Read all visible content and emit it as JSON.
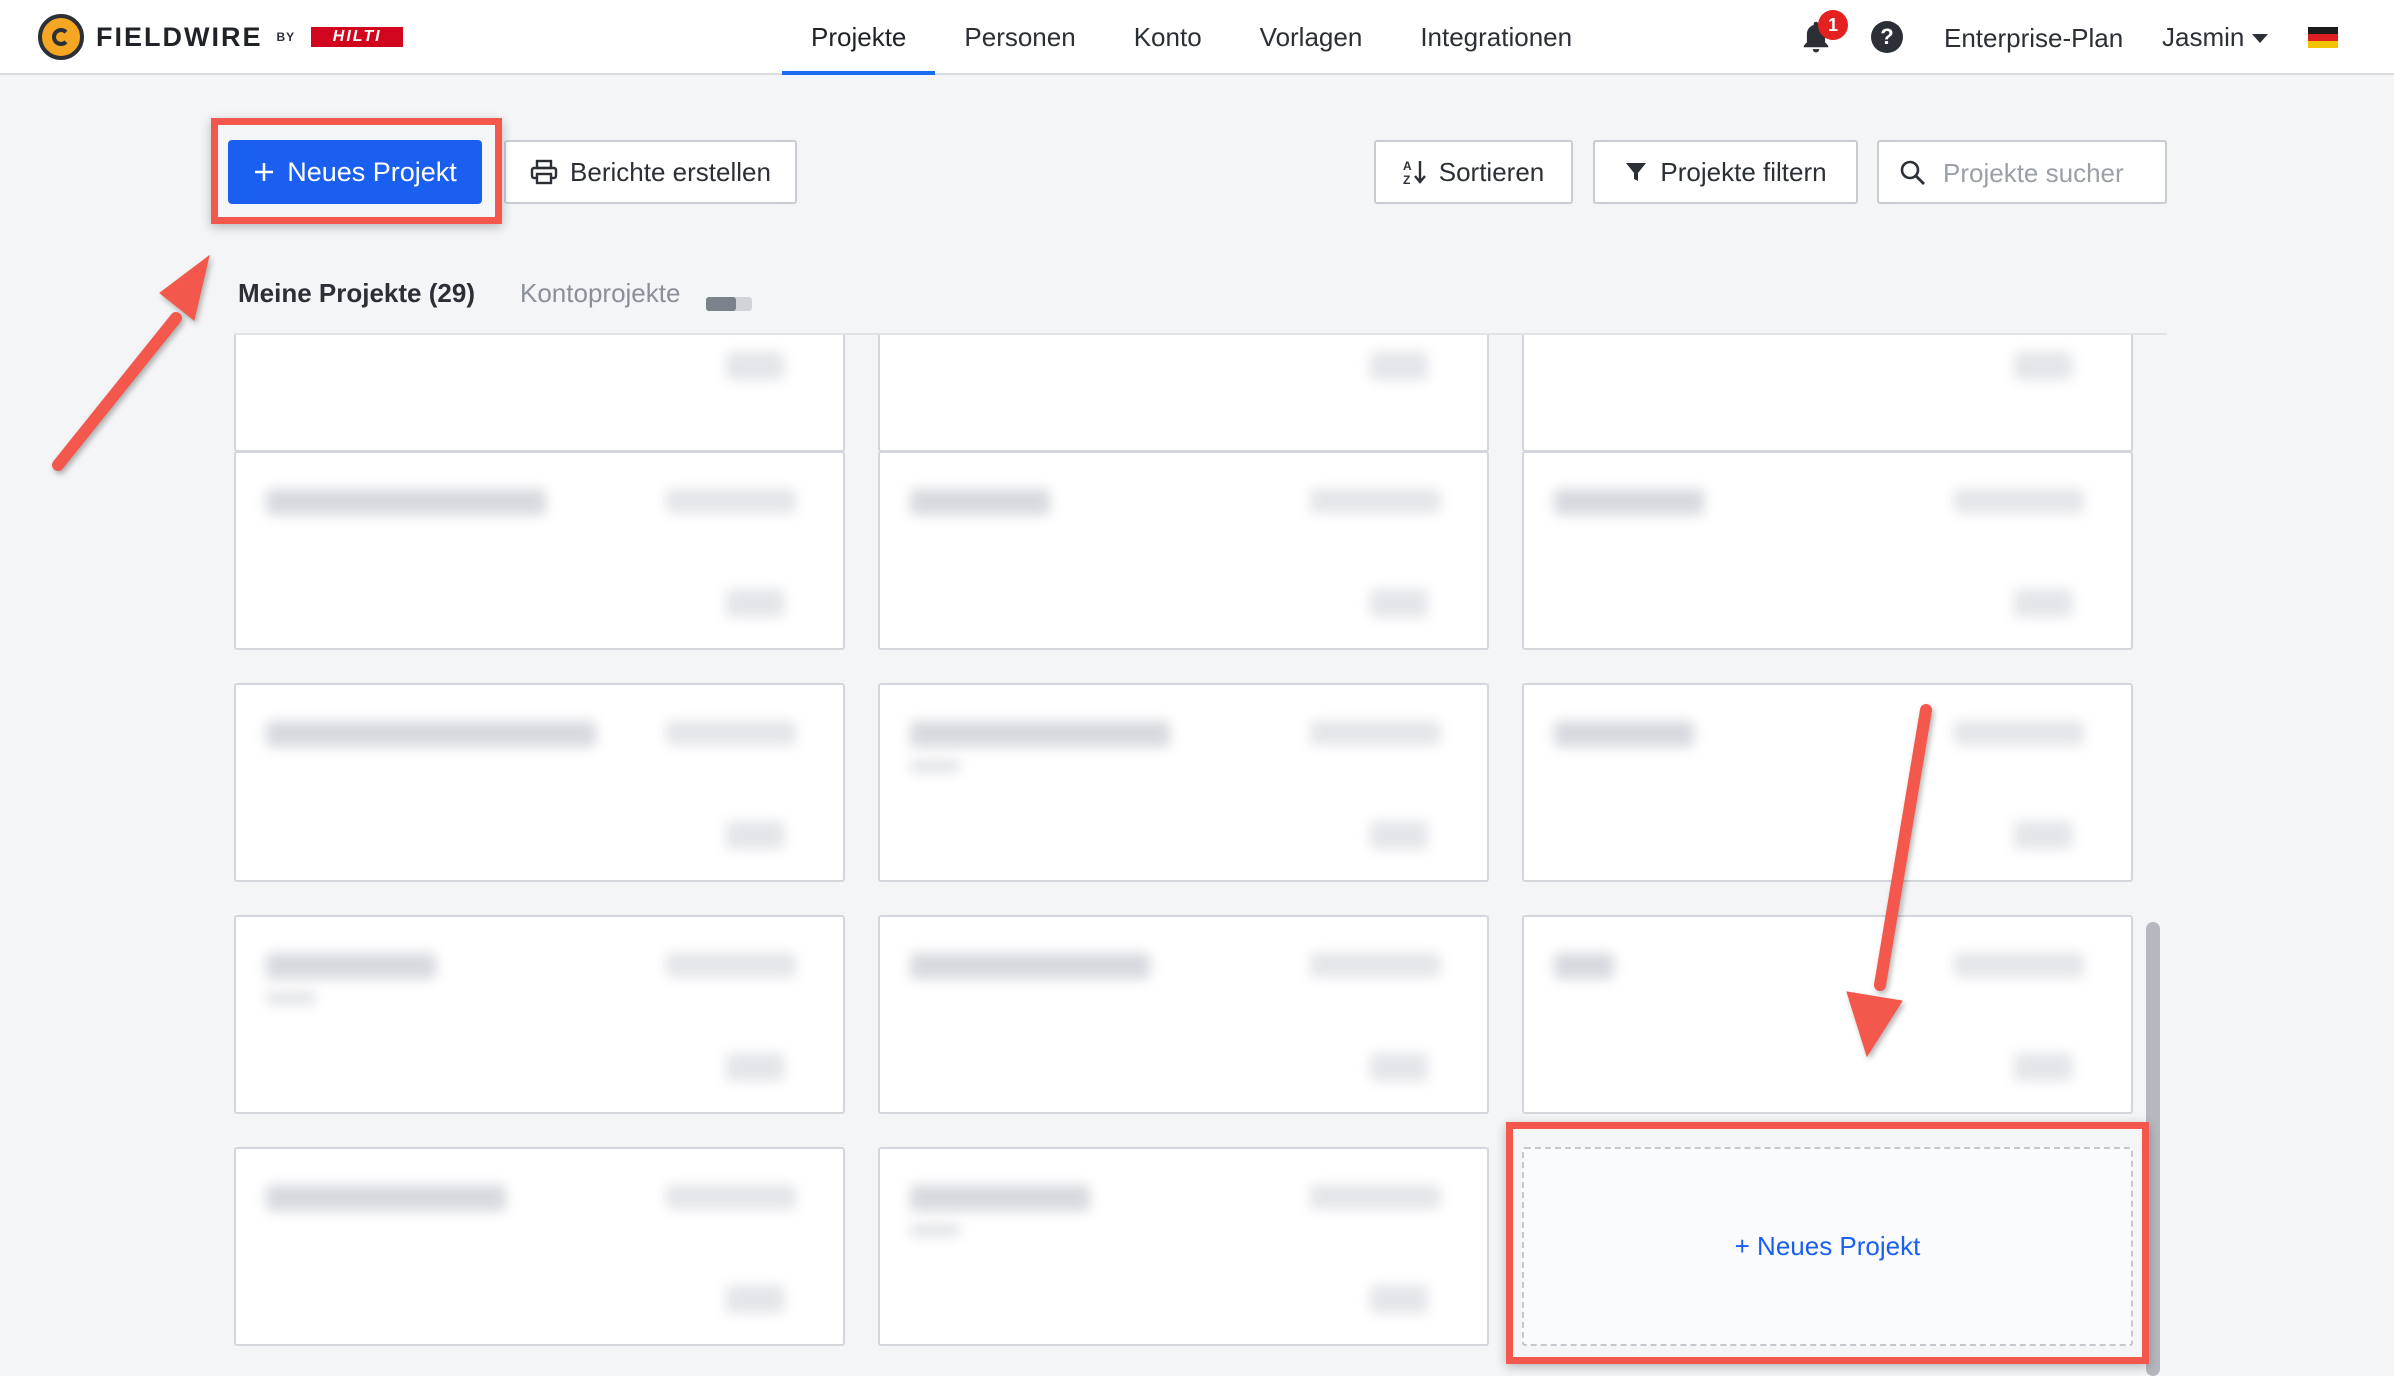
{
  "brand": {
    "name": "FIELDWIRE",
    "by": "BY",
    "partner": "HILTI"
  },
  "nav": {
    "items": [
      {
        "label": "Projekte",
        "active": true
      },
      {
        "label": "Personen",
        "active": false
      },
      {
        "label": "Konto",
        "active": false
      },
      {
        "label": "Vorlagen",
        "active": false
      },
      {
        "label": "Integrationen",
        "active": false
      }
    ]
  },
  "header": {
    "notification_count": "1",
    "help_label": "?",
    "plan": "Enterprise-Plan",
    "user": "Jasmin",
    "language_flag": "de"
  },
  "toolbar": {
    "new_project": "Neues Projekt",
    "reports": "Berichte erstellen",
    "sort": "Sortieren",
    "filter": "Projekte filtern",
    "search_placeholder": "Projekte sucher"
  },
  "tabs": {
    "my_projects": "Meine Projekte (29)",
    "account_projects": "Kontoprojekte"
  },
  "new_project_card": {
    "label": "+ Neues Projekt"
  },
  "colors": {
    "primary": "#1a5fef",
    "annotation": "#f4574b",
    "badge": "#e52020"
  }
}
